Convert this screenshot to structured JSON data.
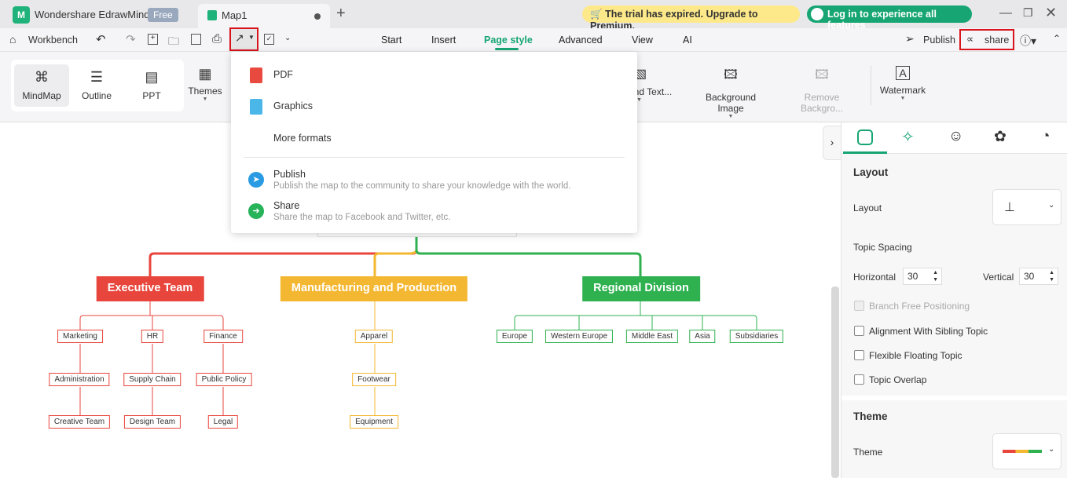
{
  "app": {
    "name": "Wondershare EdrawMind",
    "badge": "Free",
    "doc_tab": "Map1",
    "trial_notice": "The trial has expired. Upgrade to Premium.",
    "login": "Log in to experience all features"
  },
  "toolbar": {
    "workbench": "Workbench",
    "menus": [
      "Start",
      "Insert",
      "Page style",
      "Advanced",
      "View",
      "AI"
    ],
    "active_menu": "Page style",
    "publish": "Publish",
    "share": "share"
  },
  "ribbon": {
    "mindmap": "MindMap",
    "outline": "Outline",
    "ppt": "PPT",
    "themes": "Themes",
    "background_text": "und Text...",
    "background_image": "Background Image",
    "remove_background": "Remove Backgro...",
    "watermark": "Watermark"
  },
  "export_menu": {
    "pdf": "PDF",
    "graphics": "Graphics",
    "more": "More formats",
    "publish_title": "Publish",
    "publish_desc": "Publish the map to the community to share your knowledge with the world.",
    "share_title": "Share",
    "share_desc": "Share the map to Facebook and Twitter, etc."
  },
  "mindmap": {
    "branches": [
      {
        "label": "Executive Team",
        "color": "#e8453c",
        "children": [
          [
            "Marketing",
            "Administration",
            "Creative Team"
          ],
          [
            "HR",
            "Supply Chain",
            "Design Team"
          ],
          [
            "Finance",
            "Public Policy",
            "Legal"
          ]
        ]
      },
      {
        "label": "Manufacturing and Production",
        "color": "#f4b731",
        "children": [
          [
            "Apparel",
            "Footwear",
            "Equipment"
          ]
        ]
      },
      {
        "label": "Regional Division",
        "color": "#2fb150",
        "children": [
          [
            "Europe"
          ],
          [
            "Western Europe"
          ],
          [
            "Middle East"
          ],
          [
            "Asia"
          ],
          [
            "Subsidiaries"
          ]
        ]
      }
    ]
  },
  "panel": {
    "layout_heading": "Layout",
    "layout_label": "Layout",
    "topic_spacing": "Topic Spacing",
    "horizontal": "Horizontal",
    "horizontal_value": "30",
    "vertical": "Vertical",
    "vertical_value": "30",
    "options": [
      {
        "label": "Branch Free Positioning",
        "checked": false,
        "disabled": true
      },
      {
        "label": "Alignment With Sibling Topic",
        "checked": false
      },
      {
        "label": "Flexible Floating Topic",
        "checked": false
      },
      {
        "label": "Topic Overlap",
        "checked": false
      }
    ],
    "theme_heading": "Theme",
    "theme_label": "Theme"
  },
  "colors": {
    "accent": "#17a673",
    "highlight": "#d9141c"
  }
}
